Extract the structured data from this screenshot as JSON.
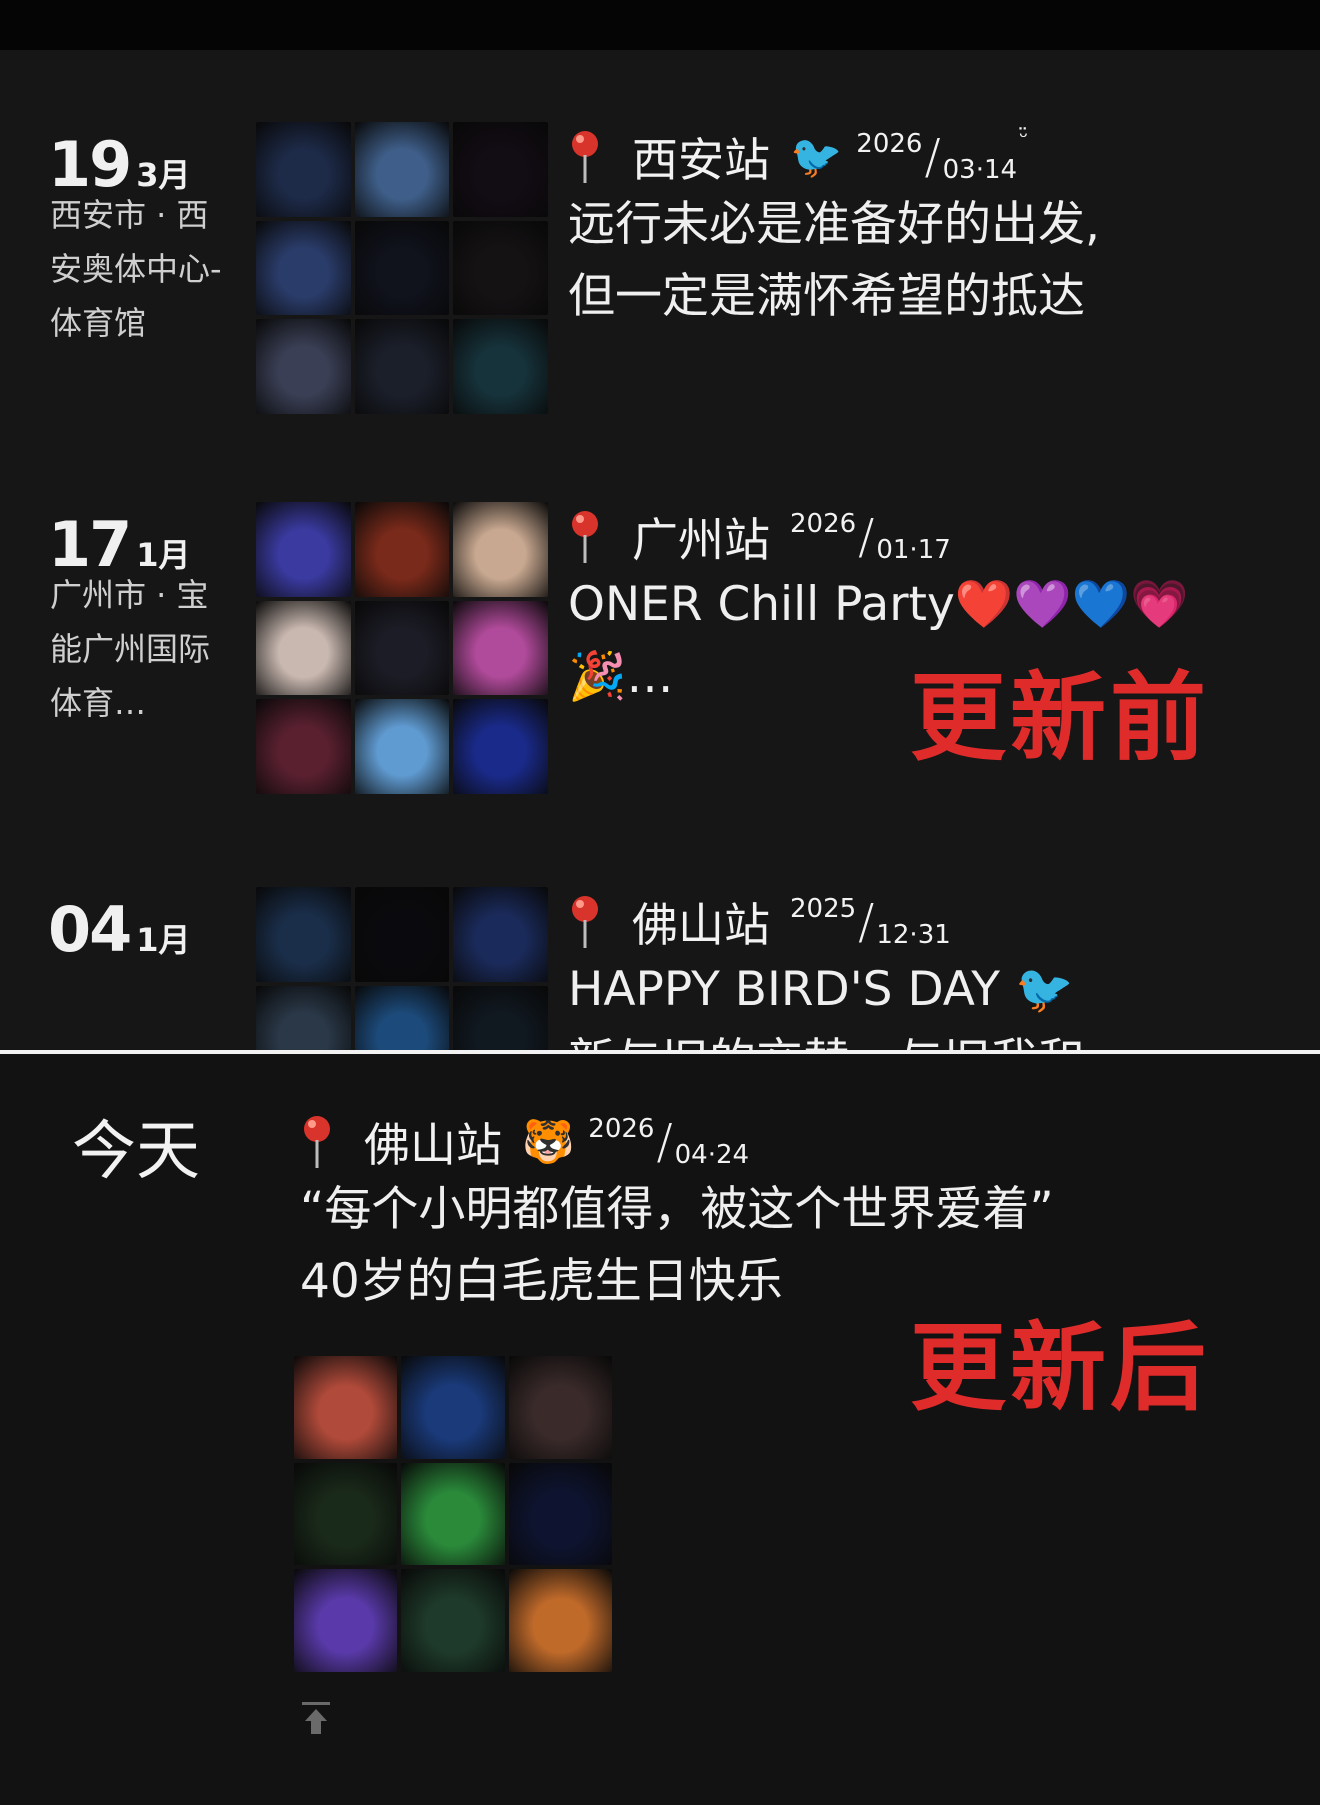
{
  "before": {
    "stamp": "更新前",
    "entries": [
      {
        "day": "19",
        "month": "3月",
        "place": "西安市 · 西安奥体中心-体育馆",
        "city": "西安站",
        "emoji": "🐦",
        "year": "2026",
        "md": "03·14",
        "tiny": "ᵕ̈",
        "text_line1": "远行未必是准备好的出发,",
        "text_line2": "但一定是满怀希望的抵达",
        "tiles": [
          "#1d2a48",
          "#3f5f8a",
          "#120c14",
          "#2a3c6a",
          "#10121c",
          "#151214",
          "#3a3f55",
          "#1b1f2a",
          "#16323a"
        ]
      },
      {
        "day": "17",
        "month": "1月",
        "place": "广州市 · 宝能广州国际体育…",
        "city": "广州站",
        "emoji": "",
        "year": "2026",
        "md": "01·17",
        "tiny": "",
        "text_line1": "ONER Chill Party❤️💜💙💗",
        "text_line2": "🎉…",
        "tiles": [
          "#3a3aa0",
          "#7a2a1a",
          "#c8a890",
          "#c9b8b0",
          "#1c1c26",
          "#b04a9a",
          "#5a2030",
          "#5f9ad0",
          "#1a2a8a"
        ]
      },
      {
        "day": "04",
        "month": "1月",
        "place": "",
        "city": "佛山站",
        "emoji": "",
        "year": "2025",
        "md": "12·31",
        "tiny": "",
        "text_line1": "HAPPY BIRD'S DAY 🐦",
        "text_line2": "新与旧的交替，与旧我和…",
        "tiles": [
          "#1a2e4a",
          "#0a0a0e",
          "#1a2a5a",
          "#2a3848",
          "#1c4a7a",
          "#101820",
          "#3a3a40",
          "#4a5a70",
          "#1a2a40"
        ]
      }
    ]
  },
  "after": {
    "stamp": "更新后",
    "today_label": "今天",
    "city": "佛山站",
    "emoji": "🐯",
    "year": "2026",
    "md": "04·24",
    "text_line1": "“每个小明都值得，被这个世界爱着”",
    "text_line2": "40岁的白毛虎生日快乐",
    "tiles": [
      "#b04a3a",
      "#1a3a7a",
      "#3a2a2a",
      "#1a2a1a",
      "#2a8a3a",
      "#0e1430",
      "#5a3aaa",
      "#1e3a2a",
      "#c06a2a"
    ],
    "scroll_top_icon": "arrow-up-to-top-icon"
  },
  "colors": {
    "background": "#161616",
    "accent_red": "#e02b2b",
    "pin_red": "#d9342b"
  }
}
